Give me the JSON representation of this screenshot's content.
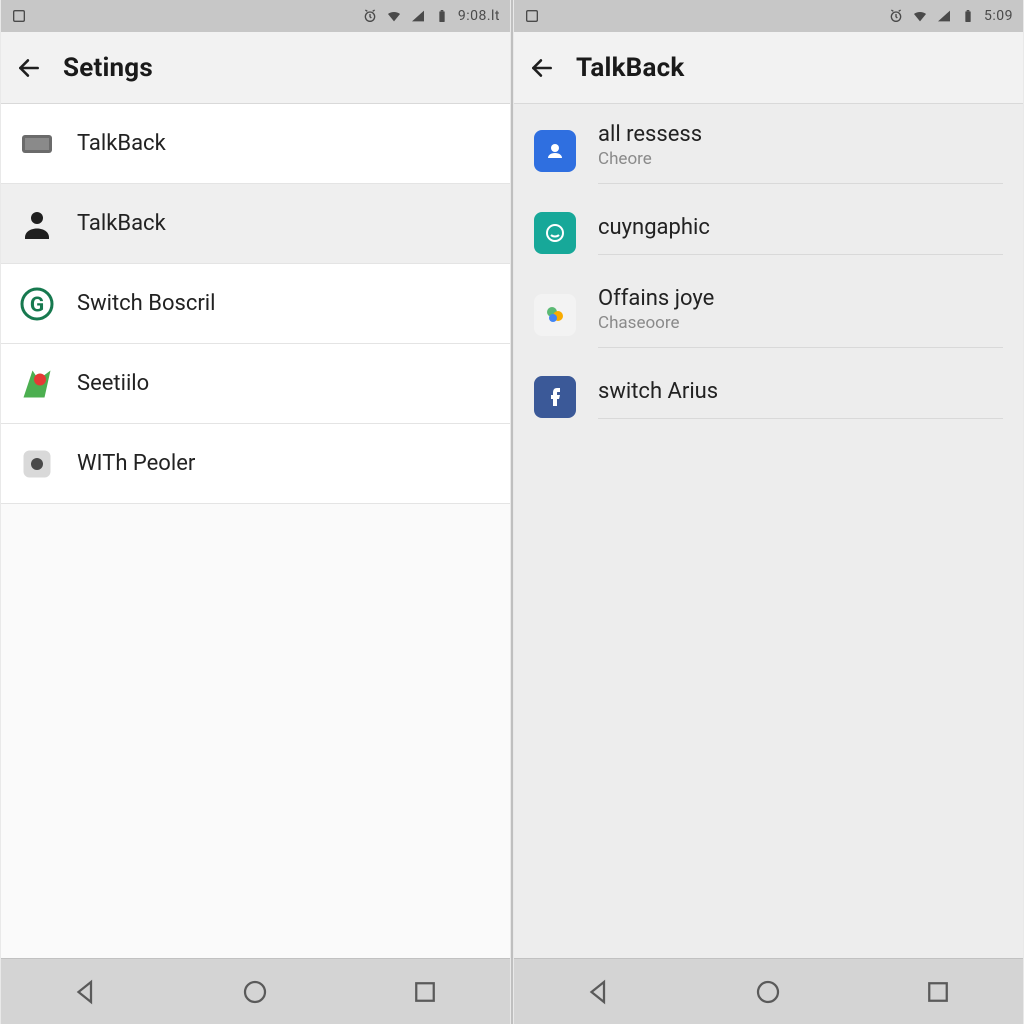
{
  "left": {
    "status": {
      "time": "9:08.lt"
    },
    "appbar": {
      "title": "Setings"
    },
    "items": [
      {
        "label": "TalkBack"
      },
      {
        "label": "TalkBack"
      },
      {
        "label": "Switch Boscril"
      },
      {
        "label": "Seetiilo"
      },
      {
        "label": "WITh Peoler"
      }
    ]
  },
  "right": {
    "status": {
      "time": "5:09"
    },
    "appbar": {
      "title": "TalkBack"
    },
    "items": [
      {
        "label": "all ressess",
        "sub": "Cheore"
      },
      {
        "label": "cuyngaphic",
        "sub": ""
      },
      {
        "label": "Offains joye",
        "sub": "Chaseoore"
      },
      {
        "label": "switch Arius",
        "sub": ""
      }
    ]
  }
}
